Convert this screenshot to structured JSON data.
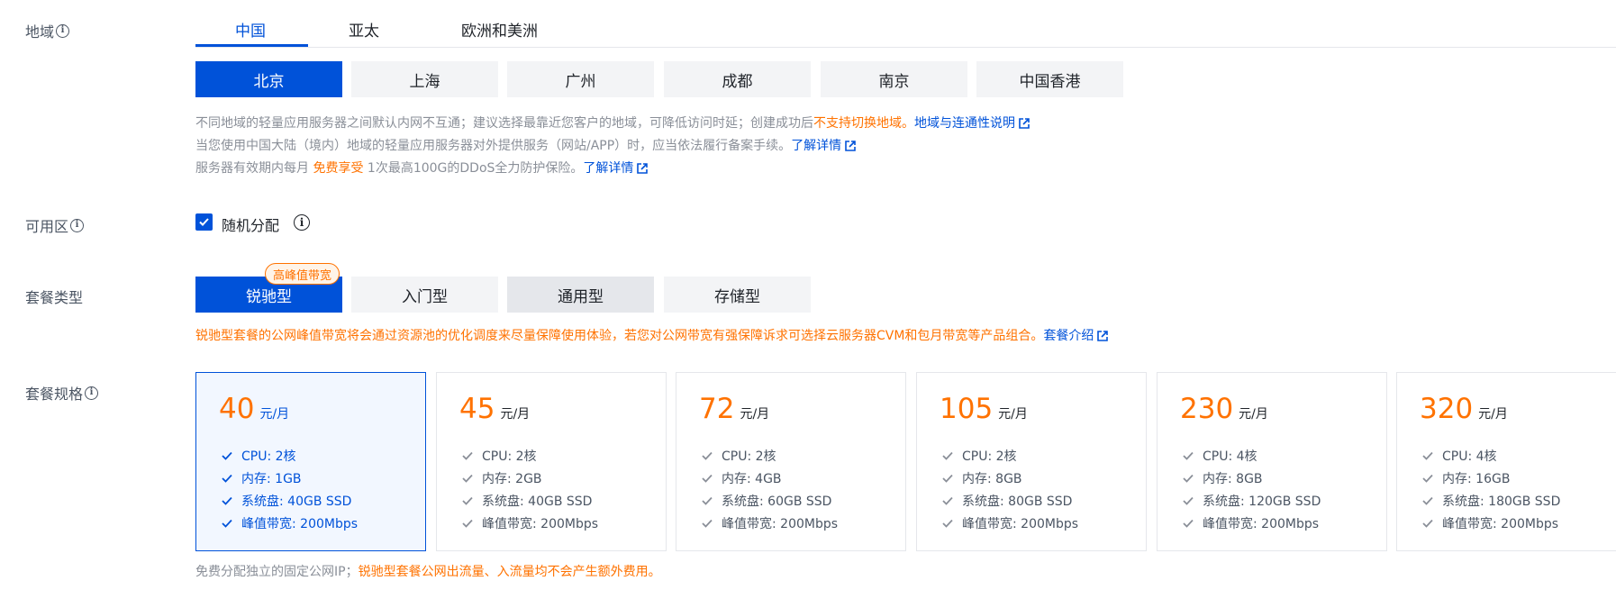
{
  "labels": {
    "region": "地域",
    "zone": "可用区",
    "plan_type": "套餐类型",
    "plan_spec": "套餐规格"
  },
  "region_tabs": [
    "中国",
    "亚太",
    "欧洲和美洲"
  ],
  "cities": [
    "北京",
    "上海",
    "广州",
    "成都",
    "南京",
    "中国香港"
  ],
  "region_notes": {
    "line1": "不同地域的轻量应用服务器之间默认内网不互通；建议选择最靠近您客户的地域，可降低访问时延；创建成功后",
    "line1_warn": "不支持切换地域。",
    "line1_link": "地域与连通性说明",
    "line2": "当您使用中国大陆（境内）地域的轻量应用服务器对外提供服务（网站/APP）时，应当依法履行备案手续。",
    "line2_link": "了解详情",
    "line3_a": "服务器有效期内每月",
    "line3_free": "免费享受",
    "line3_b": "1次最高100G的DDoS全力防护保险。",
    "line3_link": "了解详情"
  },
  "zone": {
    "checkbox_label": "随机分配",
    "checked": true
  },
  "plan_types": [
    "锐驰型",
    "入门型",
    "通用型",
    "存储型"
  ],
  "plan_badge": "高峰值带宽",
  "plan_note": "锐驰型套餐的公网峰值带宽将会通过资源池的优化调度来尽量保障使用体验，若您对公网带宽有强保障诉求可选择云服务器CVM和包月带宽等产品组合。",
  "plan_note_link": "套餐介绍",
  "price_unit": "元/月",
  "plans": [
    {
      "price": "40",
      "cpu": "CPU: 2核",
      "mem": "内存: 1GB",
      "disk": "系统盘: 40GB SSD",
      "bw": "峰值带宽: 200Mbps"
    },
    {
      "price": "45",
      "cpu": "CPU: 2核",
      "mem": "内存: 2GB",
      "disk": "系统盘: 40GB SSD",
      "bw": "峰值带宽: 200Mbps"
    },
    {
      "price": "72",
      "cpu": "CPU: 2核",
      "mem": "内存: 4GB",
      "disk": "系统盘: 60GB SSD",
      "bw": "峰值带宽: 200Mbps"
    },
    {
      "price": "105",
      "cpu": "CPU: 2核",
      "mem": "内存: 8GB",
      "disk": "系统盘: 80GB SSD",
      "bw": "峰值带宽: 200Mbps"
    },
    {
      "price": "230",
      "cpu": "CPU: 4核",
      "mem": "内存: 8GB",
      "disk": "系统盘: 120GB SSD",
      "bw": "峰值带宽: 200Mbps"
    },
    {
      "price": "320",
      "cpu": "CPU: 4核",
      "mem": "内存: 16GB",
      "disk": "系统盘: 180GB SSD",
      "bw": "峰值带宽: 200Mbps"
    }
  ],
  "bottom_note": "免费分配独立的固定公网IP；",
  "bottom_note_warn": "锐驰型套餐公网出流量、入流量均不会产生额外费用。",
  "colors": {
    "primary": "#0052d9",
    "accent": "#ff7200",
    "muted": "#8a8f98"
  }
}
